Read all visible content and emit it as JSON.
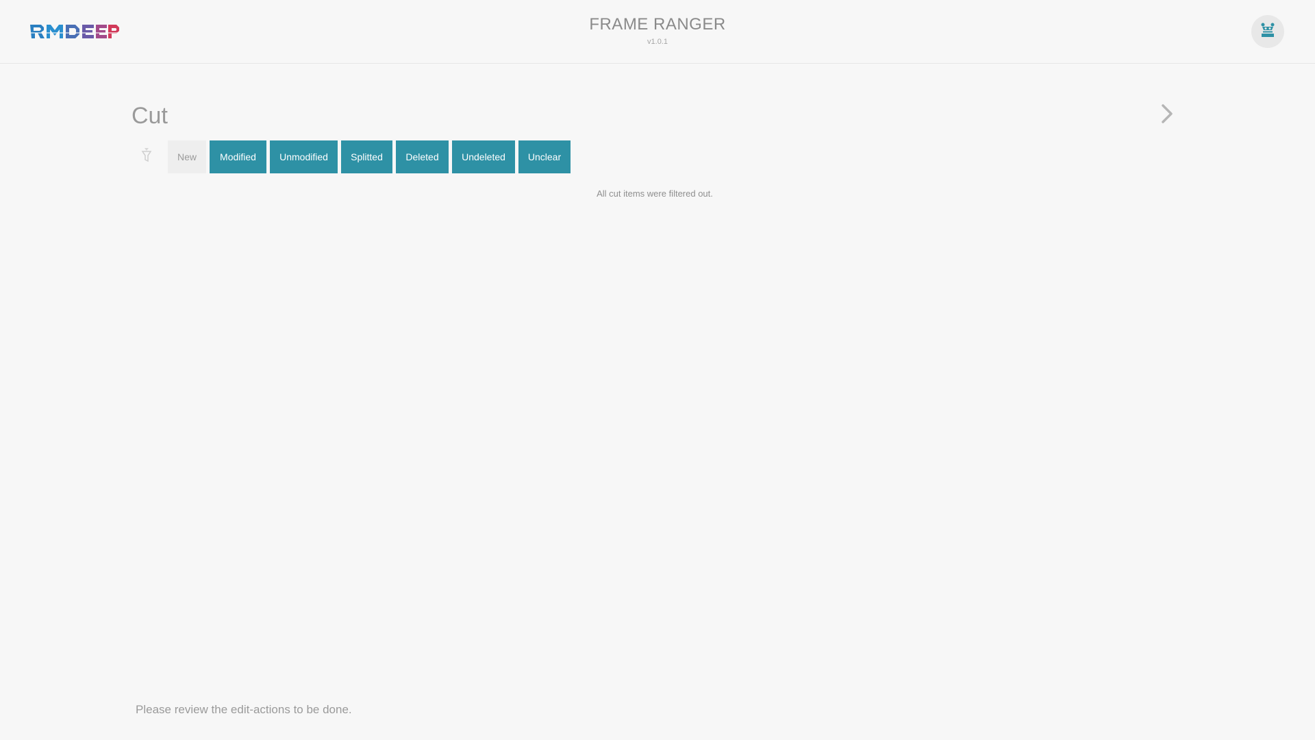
{
  "header": {
    "logo_text": "RMDEEP",
    "title": "FRAME RANGER",
    "version": "v1.0.1",
    "avatar_icon": "robot-icon"
  },
  "section": {
    "title": "Cut",
    "next_icon": "chevron-right-icon"
  },
  "filters": {
    "filter_icon": "filter-icon",
    "buttons": [
      {
        "label": "New",
        "active": false
      },
      {
        "label": "Modified",
        "active": true
      },
      {
        "label": "Unmodified",
        "active": true
      },
      {
        "label": "Splitted",
        "active": true
      },
      {
        "label": "Deleted",
        "active": true
      },
      {
        "label": "Undeleted",
        "active": true
      },
      {
        "label": "Unclear",
        "active": true
      }
    ]
  },
  "content": {
    "empty_message": "All cut items were filtered out."
  },
  "footer": {
    "message": "Please review the edit-actions to be done."
  },
  "colors": {
    "accent": "#2e91a5",
    "background": "#f7f7f7",
    "inactive_button": "#eeeeee"
  }
}
